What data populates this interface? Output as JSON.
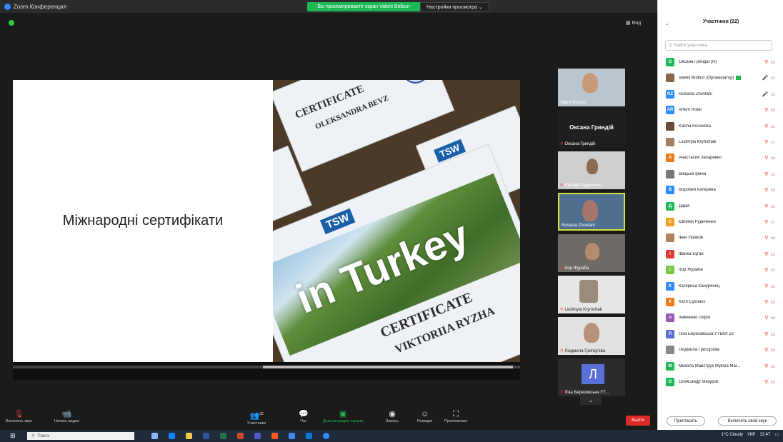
{
  "window": {
    "title": "Zoom Конференция",
    "share_banner": "Вы просматриваете экран Valerii Bolbun",
    "view_options": "Настройки просмотра ⌄",
    "view_button": "Вид",
    "minimize": "–",
    "maximize": "▢",
    "close": "✕"
  },
  "slide": {
    "title": "Міжнародні сертифікати",
    "cert_top_name": "OLEKSANDRA BEVZ",
    "cert_top_heading": "CERTIFICATE",
    "cert_brand": "TSW",
    "cert_main_word": "in Turkey",
    "cert_main_heading": "CERTIFICATE",
    "cert_main_name": "VIKTORIIA RYZHA"
  },
  "gallery": {
    "tiles": [
      {
        "name": "Valerii Bolbun",
        "muted": false
      },
      {
        "name": "Оксана Гриндій",
        "muted": true,
        "headline": "Оксана Гриндій"
      },
      {
        "name": "Євгеній Рудиченко",
        "muted": true
      },
      {
        "name": "Ruslana Zhovtani",
        "muted": false,
        "active": true
      },
      {
        "name": "Ігор Жураба",
        "muted": true
      },
      {
        "name": "Liudmyla Krymchak",
        "muted": true
      },
      {
        "name": "Людмила Григор'єва",
        "muted": true
      },
      {
        "name": "Ліза Березовська УТ...",
        "muted": true,
        "letter": "Л"
      }
    ],
    "more": "⌄"
  },
  "toolbar": {
    "audio": "Включить звук",
    "video": "Начать видео",
    "participants": "Участники",
    "participants_count": "22",
    "chat": "Чат",
    "share": "Демонстрация экрана",
    "record": "Запись",
    "reactions": "Реакции",
    "apps": "Приложения",
    "leave": "Выйти"
  },
  "panel": {
    "title": "Участники (22)",
    "search_placeholder": "Найти участника",
    "invite": "Пригласить",
    "unmute_me": "Включить свой звук",
    "participants": [
      {
        "name": "Оксана Гриндій (Я)",
        "initials": "О",
        "color": "#1db954",
        "mic_on": false,
        "cam_on": false
      },
      {
        "name": "Valerii Bolbun (Организатор)",
        "initials": "",
        "color": "#8a6a4f",
        "photo": true,
        "mic_on": true,
        "cam_on": true,
        "host": true
      },
      {
        "name": "Ruslana Zhovtani",
        "initials": "RZ",
        "color": "#2d8cff",
        "mic_on": true,
        "cam_on": true,
        "no_cam_icon": true
      },
      {
        "name": "Artem Rotar",
        "initials": "AR",
        "color": "#2d8cff",
        "mic_on": false,
        "cam_on": false
      },
      {
        "name": "Karina Kosovska",
        "initials": "",
        "color": "#6b4a3a",
        "photo": true,
        "mic_on": false,
        "cam_on": false
      },
      {
        "name": "Liudmyla Krymchak",
        "initials": "",
        "color": "#a08060",
        "photo": true,
        "mic_on": false,
        "cam_on": true
      },
      {
        "name": "Анастасия Захаренко",
        "initials": "А",
        "color": "#f07a18",
        "mic_on": false,
        "cam_on": false
      },
      {
        "name": "Вищька Ірина",
        "initials": "",
        "color": "#777",
        "photo": true,
        "mic_on": false,
        "cam_on": false
      },
      {
        "name": "Воробей Катерина",
        "initials": "В",
        "color": "#2d8cff",
        "mic_on": false,
        "cam_on": false
      },
      {
        "name": "Дарія",
        "initials": "Д",
        "color": "#1db954",
        "mic_on": false,
        "cam_on": false
      },
      {
        "name": "Євгеній Рудиченко",
        "initials": "Є",
        "color": "#f0a018",
        "mic_on": false,
        "cam_on": true
      },
      {
        "name": "Іван Ушаков",
        "initials": "",
        "color": "#b08060",
        "photo": true,
        "mic_on": false,
        "cam_on": false
      },
      {
        "name": "Іванка Бугай",
        "initials": "І",
        "color": "#e03b3b",
        "mic_on": false,
        "cam_on": false
      },
      {
        "name": "Ігор Жураба",
        "initials": "І",
        "color": "#7ac943",
        "mic_on": false,
        "cam_on": true
      },
      {
        "name": "Катерина Канурянец",
        "initials": "К",
        "color": "#2d8cff",
        "mic_on": false,
        "cam_on": false
      },
      {
        "name": "Катя Сухонос",
        "initials": "К",
        "color": "#f07a18",
        "mic_on": false,
        "cam_on": false
      },
      {
        "name": "лмвченко софія",
        "initials": "л",
        "color": "#9b59b6",
        "mic_on": false,
        "cam_on": false
      },
      {
        "name": "Ліза Березовська УТБКЛ 22",
        "initials": "Л",
        "color": "#5a6fd8",
        "mic_on": false,
        "cam_on": false
      },
      {
        "name": "Людмила Григор'єва",
        "initials": "",
        "color": "#888",
        "photo": true,
        "mic_on": false,
        "cam_on": false
      },
      {
        "name": "Микола Майструк Mykola Mai...",
        "initials": "М",
        "color": "#1db954",
        "mic_on": false,
        "cam_on": false
      },
      {
        "name": "Олександр Мазурок",
        "initials": "О",
        "color": "#1db954",
        "mic_on": false,
        "cam_on": false
      }
    ]
  },
  "taskbar": {
    "search": "Поиск",
    "weather": "1°C Cloudy",
    "lang": "УКР",
    "time": "12:47"
  }
}
